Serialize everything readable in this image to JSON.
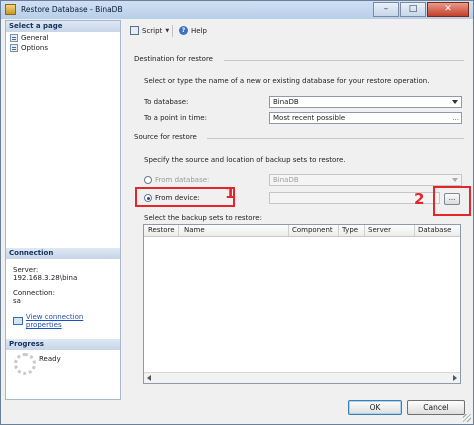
{
  "window": {
    "title": "Restore Database - BinaDB",
    "controls": {
      "minimize": "–",
      "maximize": "□",
      "close": "✕"
    }
  },
  "left_pane": {
    "select_page_header": "Select a page",
    "pages": [
      {
        "label": "General",
        "icon": "page-icon"
      },
      {
        "label": "Options",
        "icon": "page-icon"
      }
    ],
    "connection_header": "Connection",
    "server_label": "Server:",
    "server_value": "192.168.3.28\\bina",
    "connection_label": "Connection:",
    "connection_value": "sa",
    "view_connection_link": "View connection properties",
    "progress_header": "Progress",
    "progress_status": "Ready"
  },
  "toolbar": {
    "script_label": "Script",
    "help_label": "Help"
  },
  "destination": {
    "section_title": "Destination for restore",
    "instruction": "Select or type the name of a new or existing database for your restore operation.",
    "to_database_label": "To database:",
    "to_database_value": "BinaDB",
    "point_in_time_label": "To a point in time:",
    "point_in_time_value": "Most recent possible"
  },
  "source": {
    "section_title": "Source for restore",
    "instruction": "Specify the source and location of backup sets to restore.",
    "from_database_label": "From database:",
    "from_database_value": "BinaDB",
    "from_device_label": "From device:",
    "browse_label": "...",
    "select_sets_label": "Select the backup sets to restore:",
    "columns": [
      "Restore",
      "Name",
      "Component",
      "Type",
      "Server",
      "Database"
    ]
  },
  "annotations": {
    "one": "1",
    "two": "2",
    "color": "#e2262a"
  },
  "buttons": {
    "ok": "OK",
    "cancel": "Cancel"
  }
}
